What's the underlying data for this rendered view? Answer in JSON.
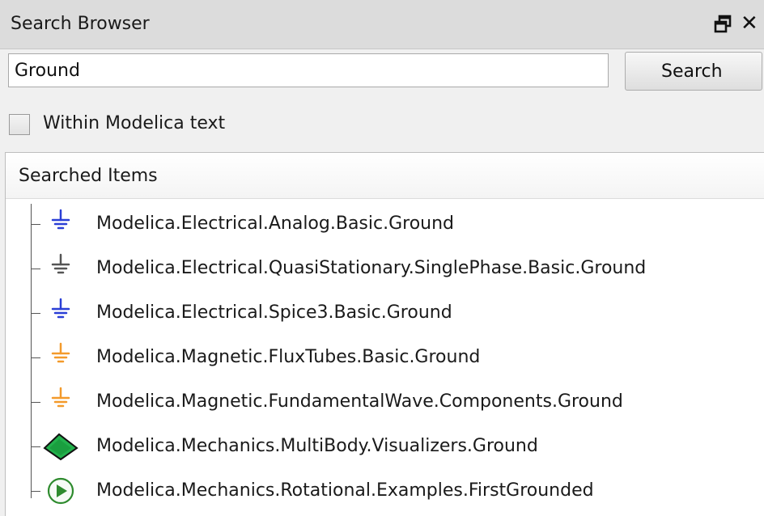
{
  "window": {
    "title": "Search Browser",
    "float_icon": "float-window-icon",
    "close_label": "✕"
  },
  "search": {
    "value": "Ground",
    "button_label": "Search"
  },
  "options": {
    "within_text_label": "Within Modelica text",
    "within_text_checked": false
  },
  "results": {
    "header": "Searched Items",
    "items": [
      {
        "label": "Modelica.Electrical.Analog.Basic.Ground",
        "icon": "ground-icon",
        "color": "#2a3fd6"
      },
      {
        "label": "Modelica.Electrical.QuasiStationary.SinglePhase.Basic.Ground",
        "icon": "ground-icon",
        "color": "#555555"
      },
      {
        "label": "Modelica.Electrical.Spice3.Basic.Ground",
        "icon": "ground-icon",
        "color": "#2a3fd6"
      },
      {
        "label": "Modelica.Magnetic.FluxTubes.Basic.Ground",
        "icon": "ground-icon",
        "color": "#f39a2b"
      },
      {
        "label": "Modelica.Magnetic.FundamentalWave.Components.Ground",
        "icon": "ground-icon",
        "color": "#f39a2b"
      },
      {
        "label": "Modelica.Mechanics.MultiBody.Visualizers.Ground",
        "icon": "green-plane-icon",
        "color": "#22b14c"
      },
      {
        "label": "Modelica.Mechanics.Rotational.Examples.FirstGrounded",
        "icon": "play-circle-icon",
        "color": "#2e8b2e"
      }
    ]
  }
}
